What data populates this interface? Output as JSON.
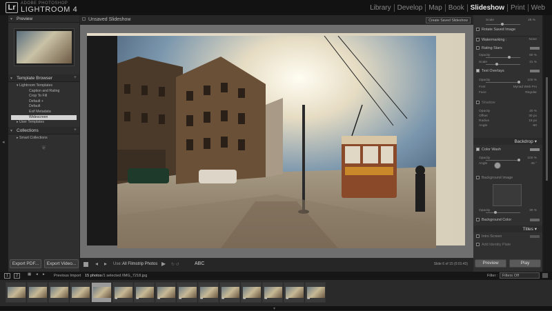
{
  "app": {
    "brand_top": "ADOBE PHOTOSHOP",
    "brand_name": "LIGHTROOM 4",
    "logo": "Lr"
  },
  "modules": [
    "Library",
    "Develop",
    "Map",
    "Book",
    "Slideshow",
    "Print",
    "Web"
  ],
  "active_module": "Slideshow",
  "left_panel": {
    "preview_title": "Preview",
    "template_browser_title": "Template Browser",
    "templates": {
      "group": "Lightroom Templates",
      "items": [
        "Caption and Rating",
        "Crop To Fill",
        "Default +",
        "Default",
        "Exif Metadata",
        "Widescreen"
      ],
      "selected": "Widescreen",
      "user": "User Templates"
    },
    "collections_title": "Collections",
    "collections_items": [
      "Smart Collections"
    ],
    "export_pdf": "Export PDF...",
    "export_video": "Export Video..."
  },
  "center": {
    "title": "Unsaved Slideshow",
    "create_button": "Create Saved Slideshow",
    "toolbar": {
      "use_label": "Use:",
      "use_value": "All Filmstrip Photos",
      "abc": "ABC",
      "status": "Slide 6 of 15 (0:01:43)"
    }
  },
  "right_panel": {
    "rows": [
      {
        "label": "Scale",
        "value": "25 %"
      },
      {
        "label": "Rotate Saved Image",
        "value": ""
      },
      {
        "label": "Watermarking :",
        "value": "None"
      },
      {
        "label": "Rating Stars",
        "value": ""
      },
      {
        "label": "Opacity",
        "value": "60 %"
      },
      {
        "label": "Scale",
        "value": "31 %"
      },
      {
        "label": "Text Overlays",
        "value": ""
      },
      {
        "label": "Opacity",
        "value": "100 %"
      },
      {
        "label": "Font",
        "value": "Myriad Web Pro"
      },
      {
        "label": "Face",
        "value": "Regular"
      },
      {
        "label": "Shadow",
        "value": ""
      },
      {
        "label": "Opacity",
        "value": "40 %"
      },
      {
        "label": "Offset",
        "value": "30 px"
      },
      {
        "label": "Radius",
        "value": "15 px"
      },
      {
        "label": "Angle",
        "value": "-90"
      }
    ],
    "backdrop_title": "Backdrop",
    "color_wash": "Color Wash",
    "cw_opacity": {
      "label": "Opacity",
      "value": "100 %"
    },
    "cw_angle": {
      "label": "Angle",
      "value": "45 °"
    },
    "background_image": "Background Image",
    "bg_opacity": {
      "label": "Opacity",
      "value": "30 %"
    },
    "background_color": "Background Color",
    "titles_title": "Titles",
    "intro_screen": "Intro Screen",
    "add_identity": "Add Identity Plate",
    "preview_button": "Preview",
    "play_button": "Play"
  },
  "filmstrip": {
    "pages": [
      "1",
      "2"
    ],
    "source_label": "Previous Import",
    "info_count": "15 photos",
    "info_rest": "/1 selected /IMG_7218.jpg",
    "filter_label": "Filter :",
    "filter_value": "Filters Off",
    "count": 15,
    "selected_index": 5
  },
  "colors": {
    "accent": "#e8e8e8",
    "panel": "#303030",
    "background": "#1e1e1e"
  }
}
